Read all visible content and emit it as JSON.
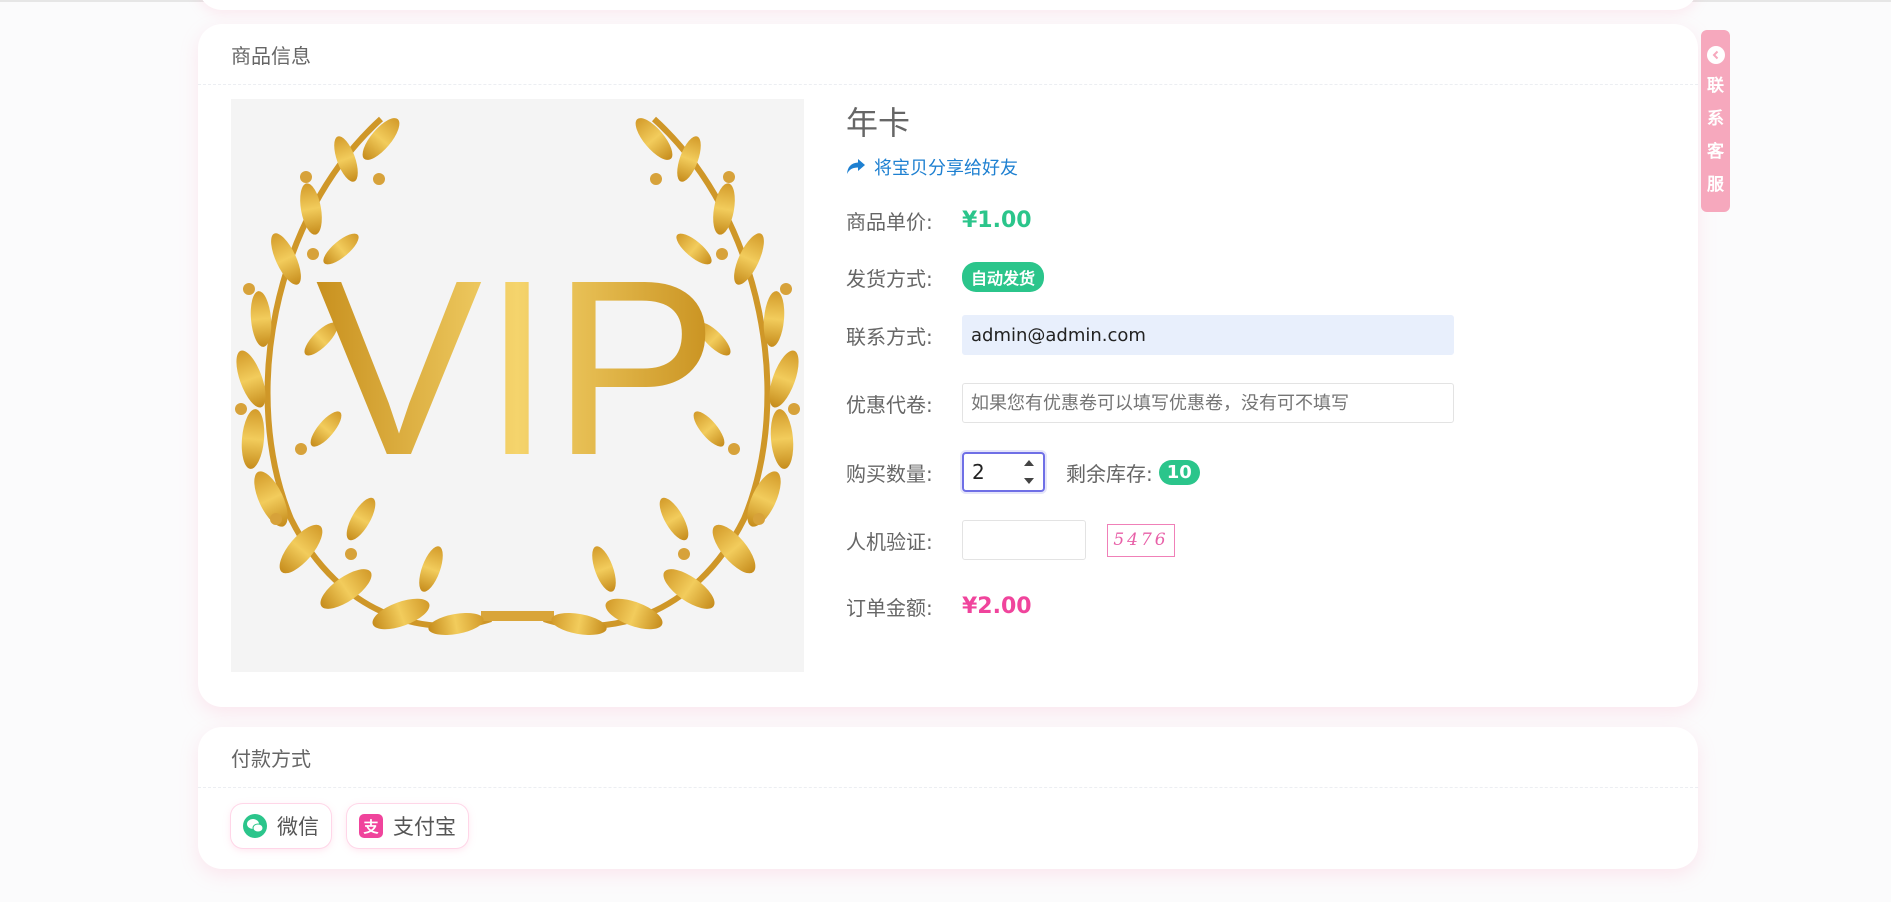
{
  "product_section": {
    "title": "商品信息",
    "product_name": "年卡",
    "share_link": "将宝贝分享给好友",
    "unit_price_label": "商品单价:",
    "unit_price": "¥1.00",
    "delivery_label": "发货方式:",
    "delivery_badge": "自动发货",
    "contact_label": "联系方式:",
    "contact_value": "admin@admin.com",
    "coupon_label": "优惠代卷:",
    "coupon_placeholder": "如果您有优惠卷可以填写优惠卷，没有可不填写",
    "quantity_label": "购买数量:",
    "quantity_value": "2",
    "stock_label": "剩余库存:",
    "stock_value": "10",
    "captcha_label": "人机验证:",
    "captcha_code": "5476",
    "total_label": "订单金额:",
    "total_value": "¥2.00",
    "image_text": "VIP"
  },
  "payment_section": {
    "title": "付款方式",
    "methods": [
      {
        "label": "微信",
        "icon": "wechat-icon",
        "color": "#2bc58b"
      },
      {
        "label": "支付宝",
        "icon": "alipay-icon",
        "color": "#f0449c"
      }
    ]
  },
  "customer_service": {
    "label": "联系客服",
    "icon": "chevron-left-icon"
  },
  "colors": {
    "accent_green": "#2bc58b",
    "accent_pink": "#f0449c",
    "link_blue": "#1e80d1",
    "side_tab": "#f6a8bd"
  }
}
